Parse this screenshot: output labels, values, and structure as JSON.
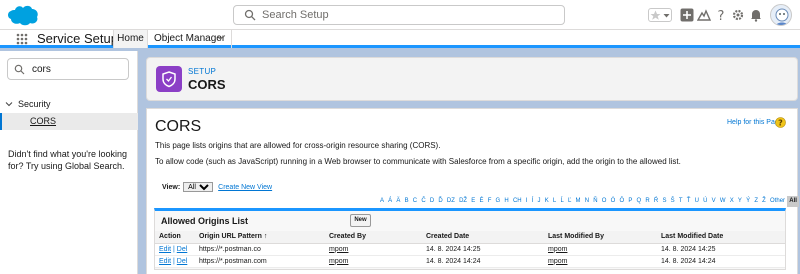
{
  "header": {
    "search_placeholder": "Search Setup"
  },
  "nav": {
    "app_name": "Service Setup",
    "tabs": [
      "Home",
      "Object Manager"
    ]
  },
  "sidebar": {
    "quickfind_value": "cors",
    "section": "Security",
    "item": "CORS",
    "no_result_text": "Didn't find what you're looking for? Try using Global Search."
  },
  "page_header": {
    "eyebrow": "SETUP",
    "title": "CORS"
  },
  "content": {
    "title": "CORS",
    "help_link": "Help for this Page",
    "description1": "This page lists origins that are allowed for cross-origin resource sharing (CORS).",
    "description2": "To allow code (such as JavaScript) running in a Web browser to communicate with Salesforce from a specific origin, add the origin to the allowed list.",
    "view_label": "View:",
    "view_value": "All",
    "create_view": "Create New View",
    "alphabet": [
      "A",
      "Á",
      "Ä",
      "B",
      "C",
      "Č",
      "D",
      "Ď",
      "DZ",
      "DŽ",
      "E",
      "É",
      "F",
      "G",
      "H",
      "CH",
      "I",
      "Í",
      "J",
      "K",
      "L",
      "Ĺ",
      "Ľ",
      "M",
      "N",
      "Ň",
      "O",
      "Ó",
      "Ô",
      "P",
      "Q",
      "R",
      "Ŕ",
      "S",
      "Š",
      "T",
      "Ť",
      "U",
      "Ú",
      "V",
      "W",
      "X",
      "Y",
      "Ý",
      "Z",
      "Ž",
      "Other",
      "All"
    ],
    "alphabet_selected": "All"
  },
  "list": {
    "title": "Allowed Origins List",
    "new_button": "New",
    "columns": [
      "Action",
      "Origin URL Pattern ↑",
      "Created By",
      "Created Date",
      "Last Modified By",
      "Last Modified Date"
    ],
    "rows": [
      {
        "edit": "Edit",
        "sep": " | ",
        "del": "Del",
        "origin": "https://*.postman.co",
        "created_by": "mpom",
        "created_date": "14. 8. 2024 14:25",
        "modified_by": "mpom",
        "modified_date": "14. 8. 2024 14:25"
      },
      {
        "edit": "Edit",
        "sep": " | ",
        "del": "Del",
        "origin": "https://*.postman.com",
        "created_by": "mpom",
        "created_date": "14. 8. 2024 14:24",
        "modified_by": "mpom",
        "modified_date": "14. 8. 2024 14:24"
      }
    ]
  },
  "colors": {
    "brand_blue": "#1b96ff",
    "link_blue": "#0176d3",
    "setup_purple": "#8b3fc6",
    "background": "#b0c4df"
  }
}
